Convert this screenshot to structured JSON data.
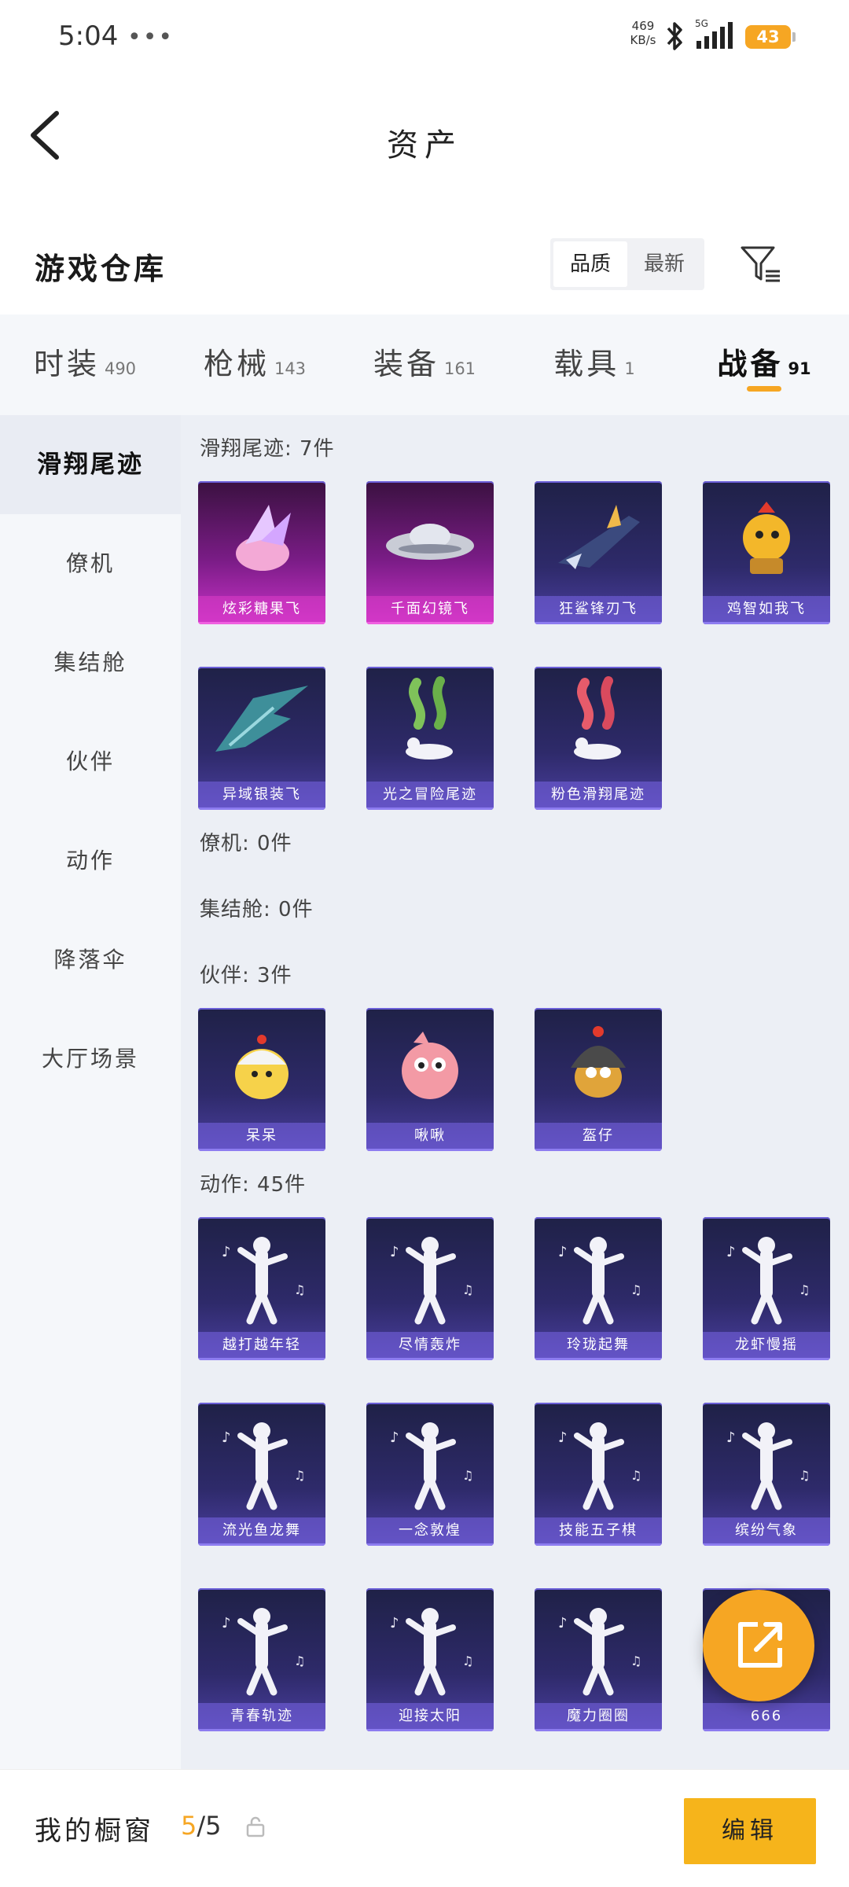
{
  "status_bar": {
    "time": "5:04",
    "dots": "•••",
    "speed_value": "469",
    "speed_unit": "KB/s",
    "network": "5G",
    "battery": "43"
  },
  "header": {
    "title": "资产"
  },
  "warehouse": {
    "title": "游戏仓库",
    "sort_options": [
      "品质",
      "最新"
    ],
    "active_sort": 0
  },
  "tabs": [
    {
      "label": "时装",
      "count": "490"
    },
    {
      "label": "枪械",
      "count": "143"
    },
    {
      "label": "装备",
      "count": "161"
    },
    {
      "label": "载具",
      "count": "1"
    },
    {
      "label": "战备",
      "count": "91"
    }
  ],
  "active_tab": 4,
  "sidebar": [
    {
      "label": "滑翔尾迹"
    },
    {
      "label": "僚机"
    },
    {
      "label": "集结舱"
    },
    {
      "label": "伙伴"
    },
    {
      "label": "动作"
    },
    {
      "label": "降落伞"
    },
    {
      "label": "大厅场景"
    }
  ],
  "sections": {
    "glide": {
      "title": "滑翔尾迹: 7件",
      "items": [
        {
          "name": "炫彩糖果飞",
          "style": "pink",
          "art": "candy-glider"
        },
        {
          "name": "千面幻镜飞",
          "style": "pink",
          "art": "ufo-glider"
        },
        {
          "name": "狂鲨锋刃飞",
          "style": "blue",
          "art": "shark-glider"
        },
        {
          "name": "鸡智如我飞",
          "style": "blue",
          "art": "chicken-glider"
        },
        {
          "name": "异域银装飞",
          "style": "blue",
          "art": "wing-glider"
        },
        {
          "name": "光之冒险尾迹",
          "style": "blue",
          "art": "green-smoke-trail"
        },
        {
          "name": "粉色滑翔尾迹",
          "style": "blue",
          "art": "pink-smoke-trail"
        }
      ]
    },
    "wingman": {
      "title": "僚机: 0件"
    },
    "pod": {
      "title": "集结舱: 0件"
    },
    "partner": {
      "title": "伙伴: 3件",
      "items": [
        {
          "name": "呆呆",
          "style": "blue",
          "art": "chick-partner"
        },
        {
          "name": "啾啾",
          "style": "blue",
          "art": "pink-bird-partner"
        },
        {
          "name": "盔仔",
          "style": "blue",
          "art": "helmet-chick-partner"
        }
      ]
    },
    "emote": {
      "title": "动作: 45件",
      "items": [
        {
          "name": "越打越年轻",
          "style": "blue",
          "art": "dance-figure"
        },
        {
          "name": "尽情轰炸",
          "style": "blue",
          "art": "dance-figure"
        },
        {
          "name": "玲珑起舞",
          "style": "blue",
          "art": "dance-figure"
        },
        {
          "name": "龙虾慢摇",
          "style": "blue",
          "art": "dance-figure"
        },
        {
          "name": "流光鱼龙舞",
          "style": "blue",
          "art": "dance-figure"
        },
        {
          "name": "一念敦煌",
          "style": "blue",
          "art": "dance-figure"
        },
        {
          "name": "技能五子棋",
          "style": "blue",
          "art": "dance-figure"
        },
        {
          "name": "缤纷气象",
          "style": "blue",
          "art": "dance-figure"
        },
        {
          "name": "青春轨迹",
          "style": "blue",
          "art": "dance-figure"
        },
        {
          "name": "迎接太阳",
          "style": "blue",
          "art": "dance-figure"
        },
        {
          "name": "魔力圈圈",
          "style": "blue",
          "art": "dance-figure"
        },
        {
          "name": "666",
          "style": "blue",
          "art": "dance-figure"
        }
      ]
    }
  },
  "bottom_bar": {
    "label": "我的橱窗",
    "used": "5",
    "total": "/5",
    "edit_label": "编辑"
  },
  "colors": {
    "accent": "#f6a623",
    "card_blue": "#2e2a6a",
    "card_pink": "#7a1c86"
  },
  "icons": [
    "back-arrow-icon",
    "filter-icon",
    "lock-icon",
    "share-icon",
    "bluetooth-icon",
    "signal-icon"
  ]
}
